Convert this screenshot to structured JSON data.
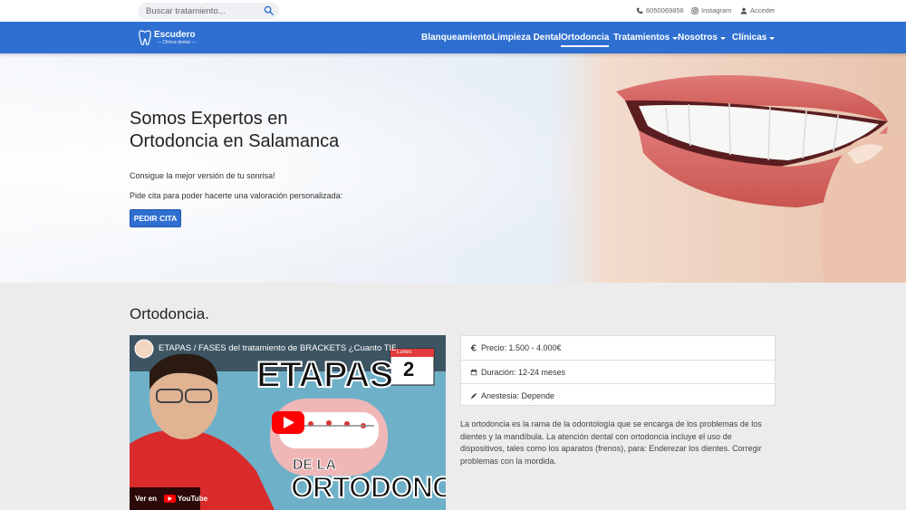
{
  "topbar": {
    "search_placeholder": "Buscar tratamiento...",
    "phone": "6050069856",
    "instagram": "Instagram",
    "login": "Acceder"
  },
  "nav": {
    "logo_name": "Escudero",
    "logo_sub": "— Clínica dental —",
    "items": [
      {
        "label": "Blanqueamiento"
      },
      {
        "label": "Limpieza Dental"
      },
      {
        "label": "Ortodoncia"
      },
      {
        "label": "Tratamientos"
      },
      {
        "label": "Nosotros"
      },
      {
        "label": "Clínicas"
      }
    ]
  },
  "hero": {
    "title_line1": "Somos Expertos en",
    "title_line2": "Ortodoncia en Salamanca",
    "p1": "Consigue la mejor versión de tu sonrisa!",
    "p2": "Pide cita para poder hacerte una valoración personalizada:",
    "cta": "PEDIR CITA"
  },
  "section": {
    "title": "Ortodoncia.",
    "video": {
      "title": "ETAPAS / FASES del tratamiento de BRACKETS ¿Cuanto TIEM...",
      "overlay_big": "ETAPAS",
      "overlay_de": "DE LA",
      "overlay_ortodoncia": "ORTODONCIA",
      "calendar_month": "Lunes",
      "calendar_day": "2",
      "watch_on": "Ver en",
      "youtube": "YouTube"
    },
    "info": {
      "price": "Precio: 1.500 - 4.000€",
      "duration": "Duración: 12-24 meses",
      "anesthesia": "Anestesia: Depende"
    },
    "description": "La ortodoncia es la rama de la odontología que se encarga de los problemas de los dientes y la mandíbula. La atención dental con ortodoncia incluye el uso de dispositivos, tales como los aparatos (frenos), para: Enderezar los dientes. Corregir problemas con la mordida."
  },
  "colors": {
    "brand_blue": "#2e6fd1",
    "section_bg": "#ececec",
    "youtube_red": "#ff0000"
  }
}
